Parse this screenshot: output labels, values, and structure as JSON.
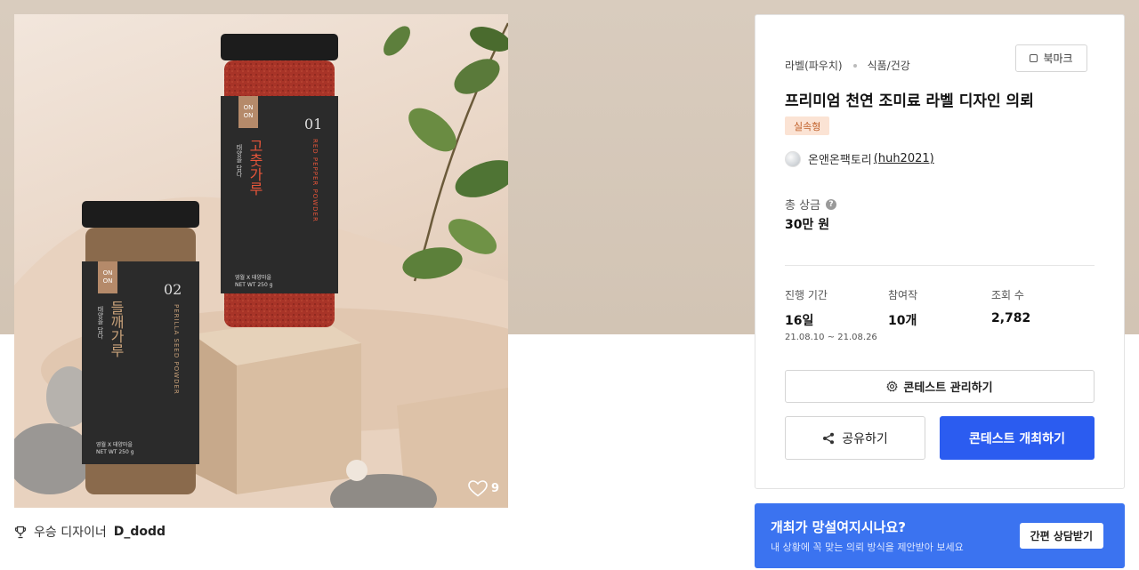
{
  "product": {
    "like_count": "9",
    "jar_1": {
      "number": "01",
      "brand": "ON ON",
      "name_ko": "고춧가루",
      "name_en": "RED PEPPER POWDER",
      "tag": "태양을 담다",
      "info_1": "영월 X 태양마을",
      "info_2": "NET WT 250 g"
    },
    "jar_2": {
      "number": "02",
      "brand": "ON ON",
      "name_ko": "들깨가루",
      "name_en": "PERILLA SEED POWDER",
      "tag": "태양을 담다",
      "info_1": "영월 X 태양마을",
      "info_2": "NET WT 250 g"
    }
  },
  "winner": {
    "label": "우승 디자이너",
    "name": "D_dodd"
  },
  "contest": {
    "category": "라벨(파우치)",
    "subcategory": "식품/건강",
    "bookmark_label": "북마크",
    "title": "프리미엄 천연 조미료 라벨 디자인 의뢰",
    "badge": "실속형",
    "host_name": "온앤온팩토리",
    "host_handle": "(huh2021)",
    "prize_label": "총 상금",
    "prize_value": "30만 원",
    "stats": {
      "period_label": "진행 기간",
      "period_value": "16일",
      "period_dates": "21.08.10 ~ 21.08.26",
      "participants_label": "참여작",
      "participants_value": "10개",
      "views_label": "조회 수",
      "views_value": "2,782"
    },
    "manage_label": "콘테스트 관리하기",
    "share_label": "공유하기",
    "host_contest_label": "콘테스트 개최하기"
  },
  "consult": {
    "title": "개최가 망설여지시나요?",
    "subtitle": "내 상황에 꼭 맞는 의뢰 방식을 제안받아 보세요",
    "button_label": "간편 상담받기"
  },
  "colors": {
    "primary": "#2b5cf0",
    "banner": "#3b73f0",
    "badge_bg": "#fbe3d4",
    "badge_text": "#c0602a",
    "hero_bg": "#d9ccbe"
  },
  "icons": [
    "heart-icon",
    "trophy-icon",
    "bookmark-icon",
    "help-icon",
    "gear-icon",
    "share-icon"
  ]
}
